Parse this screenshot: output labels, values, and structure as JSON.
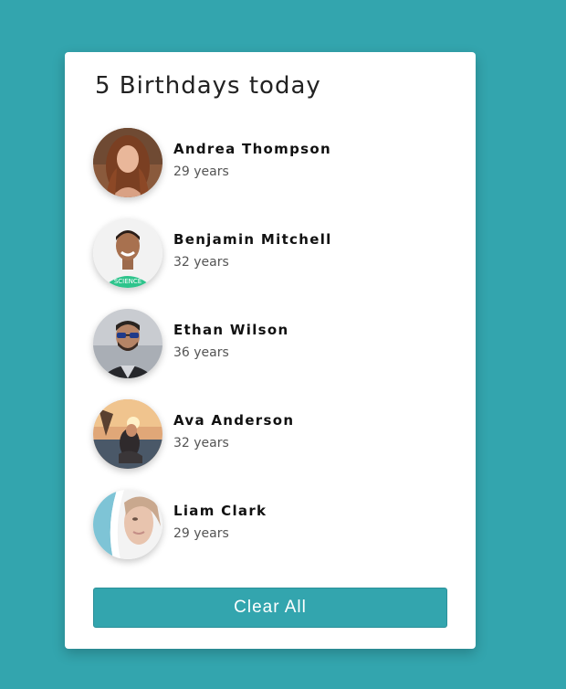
{
  "header": {
    "title": "5 Birthdays today"
  },
  "people": [
    {
      "name": "Andrea Thompson",
      "age": "29 years",
      "avatar": "woman-portrait-photo"
    },
    {
      "name": "Benjamin Mitchell",
      "age": "32 years",
      "avatar": "man-portrait-photo"
    },
    {
      "name": "Ethan Wilson",
      "age": "36 years",
      "avatar": "man-sunglasses-photo"
    },
    {
      "name": "Ava Anderson",
      "age": "32 years",
      "avatar": "woman-sunset-photo"
    },
    {
      "name": "Liam Clark",
      "age": "29 years",
      "avatar": "woman-profile-photo"
    }
  ],
  "actions": {
    "clear_label": "Clear All"
  },
  "colors": {
    "background": "#33a5ae",
    "button": "#33a5ae",
    "card": "#ffffff"
  }
}
